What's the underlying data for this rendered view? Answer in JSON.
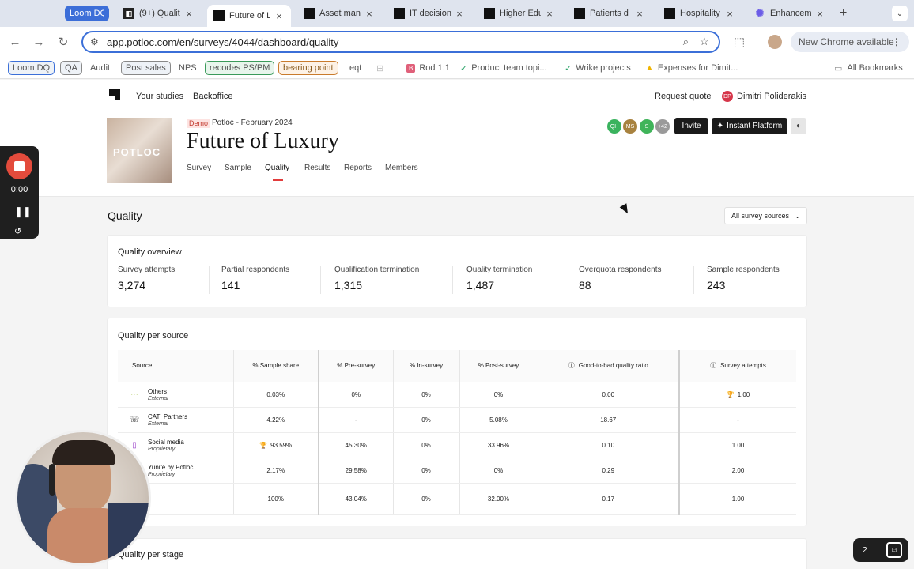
{
  "browser": {
    "tabs": [
      {
        "title": "Loom DQ"
      },
      {
        "title": "(9+) Qualit"
      },
      {
        "title": "Future of L"
      },
      {
        "title": "Asset mana"
      },
      {
        "title": "IT decision"
      },
      {
        "title": "Higher Edu"
      },
      {
        "title": "Patients d"
      },
      {
        "title": "Hospitality"
      },
      {
        "title": "Enhancem"
      }
    ],
    "url": "app.potloc.com/en/surveys/4044/dashboard/quality",
    "chrome_available": "New Chrome available",
    "bookmarks": [
      {
        "label": "Loom DQ"
      },
      {
        "label": "QA"
      },
      {
        "label": "Audit"
      },
      {
        "label": "Post sales"
      },
      {
        "label": "NPS"
      },
      {
        "label": "recodes PS/PM"
      },
      {
        "label": "bearing point"
      },
      {
        "label": "eqt"
      },
      {
        "label": "Rod 1:1"
      },
      {
        "label": "Product team topi..."
      },
      {
        "label": "Wrike projects"
      },
      {
        "label": "Expenses for Dimit..."
      }
    ],
    "all_bookmarks": "All Bookmarks"
  },
  "app": {
    "nav": {
      "your_studies": "Your studies",
      "backoffice": "Backoffice",
      "request_quote": "Request quote",
      "user_initials": "DP",
      "user_name": "Dimitri Poliderakis"
    },
    "cover_text": "POTLOC",
    "study": {
      "badge": "Demo",
      "subtitle": "Potloc - February 2024",
      "title": "Future of Luxury",
      "tabs": [
        "Survey",
        "Sample",
        "Quality",
        "Results",
        "Reports",
        "Members"
      ]
    },
    "collaborators": [
      {
        "initials": "QH",
        "color": "#3ab35e"
      },
      {
        "initials": "MS",
        "color": "#a8823f"
      },
      {
        "initials": "S",
        "color": "#40b45a"
      },
      {
        "initials": "+42",
        "color": "#9a9a9a"
      }
    ],
    "invite_label": "Invite",
    "instant_platform_label": "Instant Platform",
    "quality_title": "Quality",
    "source_filter": "All survey sources",
    "overview": {
      "title": "Quality overview",
      "metrics": [
        {
          "label": "Survey attempts",
          "value": "3,274"
        },
        {
          "label": "Partial respondents",
          "value": "141"
        },
        {
          "label": "Qualification termination",
          "value": "1,315"
        },
        {
          "label": "Quality termination",
          "value": "1,487"
        },
        {
          "label": "Overquota respondents",
          "value": "88"
        },
        {
          "label": "Sample respondents",
          "value": "243"
        }
      ]
    },
    "per_source": {
      "title": "Quality per source",
      "headers": [
        "Source",
        "% Sample share",
        "% Pre-survey",
        "% In-survey",
        "% Post-survey",
        "Good-to-bad quality ratio",
        "Survey attempts"
      ],
      "rows": [
        {
          "name": "Others",
          "type": "External",
          "cells": [
            "0.03%",
            "0%",
            "0%",
            "0%",
            "0.00",
            "1.00"
          ]
        },
        {
          "name": "CATI Partners",
          "type": "External",
          "cells": [
            "4.22%",
            "-",
            "0%",
            "5.08%",
            "18.67",
            "-"
          ]
        },
        {
          "name": "Social media",
          "type": "Proprietary",
          "cells": [
            "93.59%",
            "45.30%",
            "0%",
            "33.96%",
            "0.10",
            "1.00"
          ]
        },
        {
          "name": "Yunite by Potloc",
          "type": "Proprietary",
          "cells": [
            "2.17%",
            "29.58%",
            "0%",
            "0%",
            "0.29",
            "2.00"
          ]
        },
        {
          "name": "",
          "type": "",
          "cells": [
            "100%",
            "43.04%",
            "0%",
            "32.00%",
            "0.17",
            "1.00"
          ]
        }
      ]
    },
    "per_stage_title": "Quality per stage"
  },
  "loom": {
    "timer": "0:00"
  },
  "help_count": "2"
}
